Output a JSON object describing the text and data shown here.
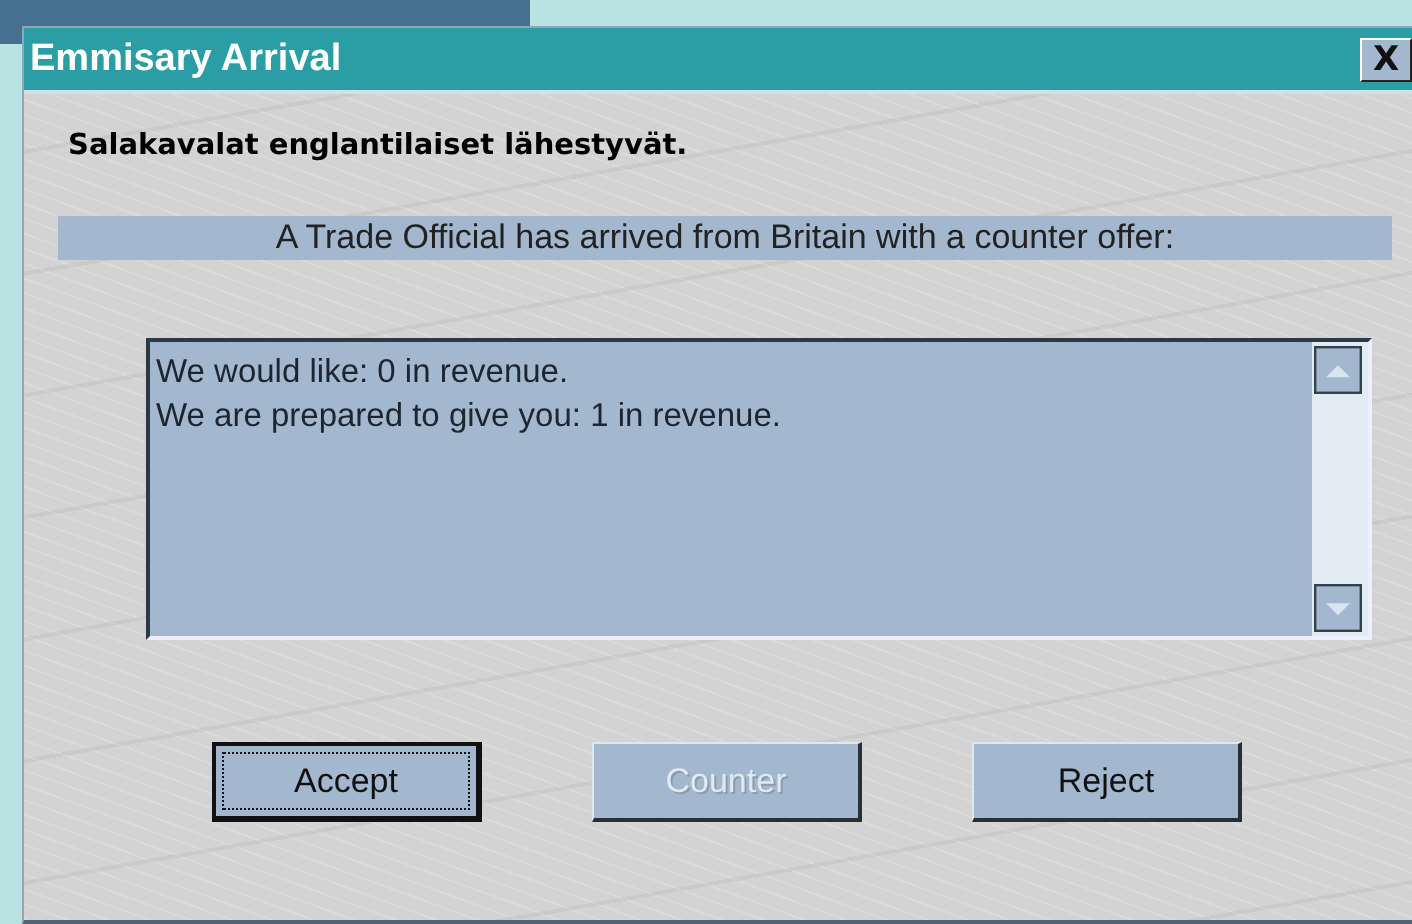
{
  "window": {
    "title": "Emmisary Arrival",
    "close": "X"
  },
  "heading": "Salakavalat englantilaiset lähestyvät.",
  "banner": "A Trade Official has arrived from Britain with a counter offer:",
  "message_lines": [
    "We would like: 0 in revenue.",
    "We are prepared to give you: 1 in revenue."
  ],
  "buttons": [
    {
      "label": "Accept",
      "disabled": false,
      "focused": true
    },
    {
      "label": "Counter",
      "disabled": true,
      "focused": false
    },
    {
      "label": "Reject",
      "disabled": false,
      "focused": false
    }
  ]
}
